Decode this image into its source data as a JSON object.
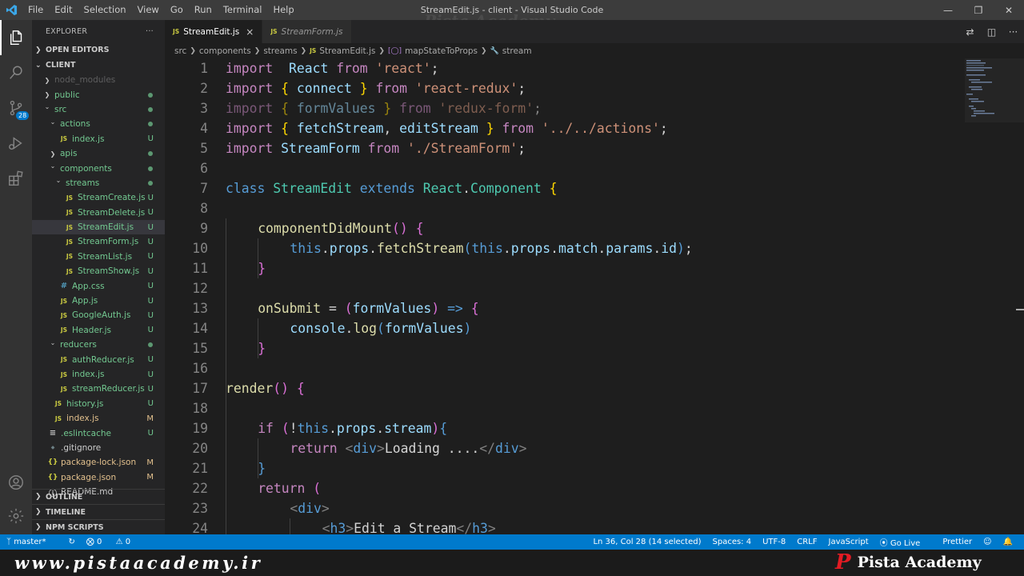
{
  "window": {
    "title": "StreamEdit.js - client - Visual Studio Code",
    "menu": [
      "File",
      "Edit",
      "Selection",
      "View",
      "Go",
      "Run",
      "Terminal",
      "Help"
    ],
    "watermark_top": "Pista Academy"
  },
  "activity": {
    "scm_badge": "28",
    "items": [
      "explorer-icon",
      "search-icon",
      "source-control-icon",
      "run-debug-icon",
      "extensions-icon",
      "account-icon",
      "settings-gear-icon"
    ]
  },
  "sidebar": {
    "title": "EXPLORER",
    "more": "···",
    "open_editors": "OPEN EDITORS",
    "root": "CLIENT",
    "tree": [
      {
        "label": "node_modules",
        "type": "folder-closed",
        "depth": 1,
        "status": "",
        "style": "dim"
      },
      {
        "label": "public",
        "type": "folder-closed",
        "depth": 1,
        "status": "dot",
        "style": "untracked"
      },
      {
        "label": "src",
        "type": "folder-open",
        "depth": 1,
        "status": "dot",
        "style": "untracked"
      },
      {
        "label": "actions",
        "type": "folder-open",
        "depth": 2,
        "status": "dot",
        "style": "untracked"
      },
      {
        "label": "index.js",
        "type": "js",
        "depth": 3,
        "status": "U",
        "style": "untracked"
      },
      {
        "label": "apis",
        "type": "folder-closed",
        "depth": 2,
        "status": "dot",
        "style": "untracked"
      },
      {
        "label": "components",
        "type": "folder-open",
        "depth": 2,
        "status": "dot",
        "style": "untracked"
      },
      {
        "label": "streams",
        "type": "folder-open",
        "depth": 3,
        "status": "dot",
        "style": "untracked"
      },
      {
        "label": "StreamCreate.js",
        "type": "js",
        "depth": 4,
        "status": "U",
        "style": "untracked"
      },
      {
        "label": "StreamDelete.js",
        "type": "js",
        "depth": 4,
        "status": "U",
        "style": "untracked"
      },
      {
        "label": "StreamEdit.js",
        "type": "js",
        "depth": 4,
        "status": "U",
        "style": "untracked",
        "selected": true
      },
      {
        "label": "StreamForm.js",
        "type": "js",
        "depth": 4,
        "status": "U",
        "style": "untracked"
      },
      {
        "label": "StreamList.js",
        "type": "js",
        "depth": 4,
        "status": "U",
        "style": "untracked"
      },
      {
        "label": "StreamShow.js",
        "type": "js",
        "depth": 4,
        "status": "U",
        "style": "untracked"
      },
      {
        "label": "App.css",
        "type": "css",
        "depth": 3,
        "status": "U",
        "style": "untracked"
      },
      {
        "label": "App.js",
        "type": "js",
        "depth": 3,
        "status": "U",
        "style": "untracked"
      },
      {
        "label": "GoogleAuth.js",
        "type": "js",
        "depth": 3,
        "status": "U",
        "style": "untracked"
      },
      {
        "label": "Header.js",
        "type": "js",
        "depth": 3,
        "status": "U",
        "style": "untracked"
      },
      {
        "label": "reducers",
        "type": "folder-open",
        "depth": 2,
        "status": "dot",
        "style": "untracked"
      },
      {
        "label": "authReducer.js",
        "type": "js",
        "depth": 3,
        "status": "U",
        "style": "untracked"
      },
      {
        "label": "index.js",
        "type": "js",
        "depth": 3,
        "status": "U",
        "style": "untracked"
      },
      {
        "label": "streamReducer.js",
        "type": "js",
        "depth": 3,
        "status": "U",
        "style": "untracked"
      },
      {
        "label": "history.js",
        "type": "js",
        "depth": 2,
        "status": "U",
        "style": "untracked"
      },
      {
        "label": "index.js",
        "type": "js",
        "depth": 2,
        "status": "M",
        "style": "modified"
      },
      {
        "label": ".eslintcache",
        "type": "txt",
        "depth": 1,
        "status": "U",
        "style": "untracked"
      },
      {
        "label": ".gitignore",
        "type": "git",
        "depth": 1,
        "status": "",
        "style": "plain"
      },
      {
        "label": "package-lock.json",
        "type": "json",
        "depth": 1,
        "status": "M",
        "style": "modified"
      },
      {
        "label": "package.json",
        "type": "json",
        "depth": 1,
        "status": "M",
        "style": "modified"
      },
      {
        "label": "README.md",
        "type": "md",
        "depth": 1,
        "status": "",
        "style": "plain"
      }
    ],
    "outline": "OUTLINE",
    "timeline": "TIMELINE",
    "npm_scripts": "NPM SCRIPTS"
  },
  "tabs": [
    {
      "label": "StreamEdit.js",
      "icon": "JS",
      "active": true,
      "close": "×"
    },
    {
      "label": "StreamForm.js",
      "icon": "JS",
      "active": false
    }
  ],
  "breadcrumb": {
    "parts": [
      "src",
      "components",
      "streams"
    ],
    "file": "StreamEdit.js",
    "file_icon": "JS",
    "symbol1": "mapStateToProps",
    "symbol2": "stream"
  },
  "code": {
    "lines": [
      {
        "n": "1",
        "indent": 0,
        "tokens": [
          [
            "k",
            "import"
          ],
          [
            "",
            "  "
          ],
          [
            "v",
            "React"
          ],
          [
            "",
            " "
          ],
          [
            "k",
            "from"
          ],
          [
            "",
            " "
          ],
          [
            "s",
            "'react'"
          ],
          [
            "",
            ";"
          ]
        ]
      },
      {
        "n": "2",
        "indent": 0,
        "tokens": [
          [
            "k",
            "import"
          ],
          [
            "",
            " "
          ],
          [
            "y",
            "{"
          ],
          [
            "",
            " "
          ],
          [
            "v",
            "connect"
          ],
          [
            "",
            " "
          ],
          [
            "y",
            "}"
          ],
          [
            "",
            " "
          ],
          [
            "k",
            "from"
          ],
          [
            "",
            " "
          ],
          [
            "s",
            "'react-redux'"
          ],
          [
            "",
            ";"
          ]
        ]
      },
      {
        "n": "3",
        "indent": 0,
        "dim": true,
        "tokens": [
          [
            "k",
            "import"
          ],
          [
            "",
            " "
          ],
          [
            "y",
            "{"
          ],
          [
            "",
            " "
          ],
          [
            "v",
            "formValues"
          ],
          [
            "",
            " "
          ],
          [
            "y",
            "}"
          ],
          [
            "",
            " "
          ],
          [
            "k",
            "from"
          ],
          [
            "",
            " "
          ],
          [
            "s",
            "'redux-form'"
          ],
          [
            "",
            ";"
          ]
        ]
      },
      {
        "n": "4",
        "indent": 0,
        "tokens": [
          [
            "k",
            "import"
          ],
          [
            "",
            " "
          ],
          [
            "y",
            "{"
          ],
          [
            "",
            " "
          ],
          [
            "v",
            "fetchStream"
          ],
          [
            "",
            ", "
          ],
          [
            "v",
            "editStream"
          ],
          [
            "",
            " "
          ],
          [
            "y",
            "}"
          ],
          [
            "",
            " "
          ],
          [
            "k",
            "from"
          ],
          [
            "",
            " "
          ],
          [
            "s",
            "'../../actions'"
          ],
          [
            "",
            ";"
          ]
        ]
      },
      {
        "n": "5",
        "indent": 0,
        "tokens": [
          [
            "k",
            "import"
          ],
          [
            "",
            " "
          ],
          [
            "v",
            "StreamForm"
          ],
          [
            "",
            " "
          ],
          [
            "k",
            "from"
          ],
          [
            "",
            " "
          ],
          [
            "s",
            "'./StreamForm'"
          ],
          [
            "",
            ";"
          ]
        ]
      },
      {
        "n": "6",
        "indent": 0,
        "tokens": []
      },
      {
        "n": "7",
        "indent": 0,
        "tokens": [
          [
            "b",
            "class"
          ],
          [
            "",
            " "
          ],
          [
            "t",
            "StreamEdit"
          ],
          [
            "",
            " "
          ],
          [
            "b",
            "extends"
          ],
          [
            "",
            " "
          ],
          [
            "t",
            "React"
          ],
          [
            "",
            "."
          ],
          [
            "t",
            "Component"
          ],
          [
            "",
            " "
          ],
          [
            "y",
            "{"
          ]
        ]
      },
      {
        "n": "8",
        "indent": 0,
        "tokens": []
      },
      {
        "n": "9",
        "indent": 1,
        "tokens": [
          [
            "f",
            "componentDidMount"
          ],
          [
            "p",
            "()"
          ],
          [
            "",
            " "
          ],
          [
            "p",
            "{"
          ]
        ]
      },
      {
        "n": "10",
        "indent": 2,
        "tokens": [
          [
            "b",
            "this"
          ],
          [
            "",
            "."
          ],
          [
            "v",
            "props"
          ],
          [
            "",
            "."
          ],
          [
            "f",
            "fetchStream"
          ],
          [
            "b",
            "("
          ],
          [
            "b",
            "this"
          ],
          [
            "",
            "."
          ],
          [
            "v",
            "props"
          ],
          [
            "",
            "."
          ],
          [
            "v",
            "match"
          ],
          [
            "",
            "."
          ],
          [
            "v",
            "params"
          ],
          [
            "",
            "."
          ],
          [
            "v",
            "id"
          ],
          [
            "b",
            ")"
          ],
          [
            "",
            ";"
          ]
        ]
      },
      {
        "n": "11",
        "indent": 1,
        "tokens": [
          [
            "p",
            "}"
          ]
        ]
      },
      {
        "n": "12",
        "indent": 0,
        "tokens": []
      },
      {
        "n": "13",
        "indent": 1,
        "tokens": [
          [
            "f",
            "onSubmit"
          ],
          [
            "",
            " = "
          ],
          [
            "p",
            "("
          ],
          [
            "v",
            "formValues"
          ],
          [
            "p",
            ")"
          ],
          [
            "",
            " "
          ],
          [
            "b",
            "=>"
          ],
          [
            "",
            " "
          ],
          [
            "p",
            "{"
          ]
        ]
      },
      {
        "n": "14",
        "indent": 2,
        "tokens": [
          [
            "v",
            "console"
          ],
          [
            "",
            "."
          ],
          [
            "f",
            "log"
          ],
          [
            "b",
            "("
          ],
          [
            "v",
            "formValues"
          ],
          [
            "b",
            ")"
          ]
        ]
      },
      {
        "n": "15",
        "indent": 1,
        "tokens": [
          [
            "p",
            "}"
          ]
        ]
      },
      {
        "n": "16",
        "indent": 0,
        "tokens": []
      },
      {
        "n": "17",
        "indent": 0,
        "tokens": [
          [
            "f",
            "render"
          ],
          [
            "p",
            "()"
          ],
          [
            "",
            " "
          ],
          [
            "p",
            "{"
          ]
        ]
      },
      {
        "n": "18",
        "indent": 0,
        "tokens": []
      },
      {
        "n": "19",
        "indent": 1,
        "tokens": [
          [
            "k",
            "if"
          ],
          [
            "",
            " "
          ],
          [
            "p",
            "("
          ],
          [
            "",
            "!"
          ],
          [
            "b",
            "this"
          ],
          [
            "",
            "."
          ],
          [
            "v",
            "props"
          ],
          [
            "",
            "."
          ],
          [
            "v",
            "stream"
          ],
          [
            "p",
            ")"
          ],
          [
            "b",
            "{"
          ]
        ]
      },
      {
        "n": "20",
        "indent": 2,
        "tokens": [
          [
            "k",
            "return"
          ],
          [
            "",
            " "
          ],
          [
            "an",
            "<"
          ],
          [
            "tg",
            "div"
          ],
          [
            "an",
            ">"
          ],
          [
            "",
            "Loading ...."
          ],
          [
            "an",
            "</"
          ],
          [
            "tg",
            "div"
          ],
          [
            "an",
            ">"
          ]
        ]
      },
      {
        "n": "21",
        "indent": 1,
        "tokens": [
          [
            "b",
            "}"
          ]
        ]
      },
      {
        "n": "22",
        "indent": 1,
        "tokens": [
          [
            "k",
            "return"
          ],
          [
            "",
            " "
          ],
          [
            "p",
            "("
          ]
        ]
      },
      {
        "n": "23",
        "indent": 2,
        "tokens": [
          [
            "an",
            "<"
          ],
          [
            "tg",
            "div"
          ],
          [
            "an",
            ">"
          ]
        ]
      },
      {
        "n": "24",
        "indent": 3,
        "tokens": [
          [
            "an",
            "<"
          ],
          [
            "tg",
            "h3"
          ],
          [
            "an",
            ">"
          ],
          [
            "",
            "Edit a Stream"
          ],
          [
            "an",
            "</"
          ],
          [
            "tg",
            "h3"
          ],
          [
            "an",
            ">"
          ]
        ]
      }
    ]
  },
  "statusbar": {
    "branch": "master*",
    "errors": "0",
    "warnings": "0",
    "position": "Ln 36, Col 28 (14 selected)",
    "spaces": "Spaces: 4",
    "encoding": "UTF-8",
    "eol": "CRLF",
    "language": "JavaScript",
    "golive": "Go Live",
    "prettier": "Prettier"
  },
  "watermark": {
    "site": "www.pistaacademy.ir",
    "brand": "Pista Academy",
    "logo_letter": "P"
  },
  "colors": {
    "accent": "#007acc",
    "untracked": "#73c991",
    "modified": "#e2c08d",
    "brand_red": "#e31b23"
  }
}
